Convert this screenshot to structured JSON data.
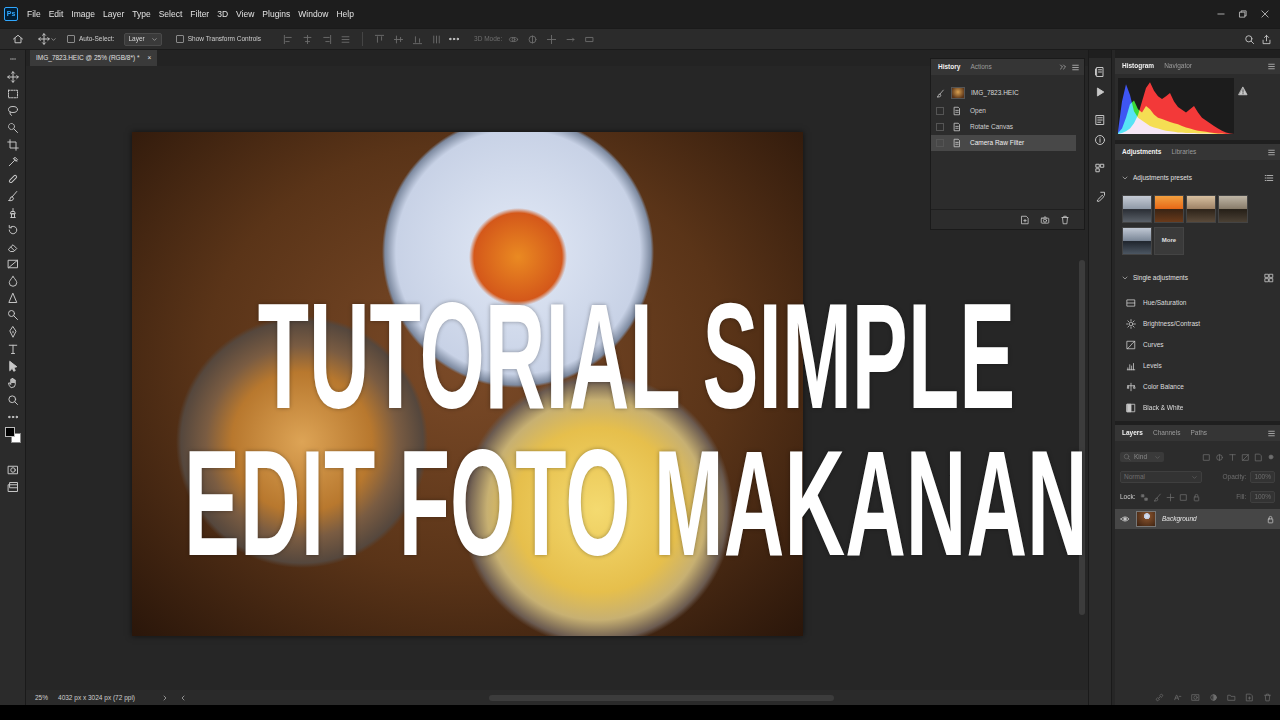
{
  "app": {
    "logo": "Ps"
  },
  "menu": [
    "File",
    "Edit",
    "Image",
    "Layer",
    "Type",
    "Select",
    "Filter",
    "3D",
    "View",
    "Plugins",
    "Window",
    "Help"
  ],
  "options_bar": {
    "auto_select": {
      "label": "Auto-Select:",
      "checked": false
    },
    "target": "Layer",
    "show_transform": {
      "label": "Show Transform Controls",
      "checked": false
    },
    "mode_3d": {
      "label": "3D Mode:",
      "disabled": true
    }
  },
  "document_tab": {
    "title": "IMG_7823.HEIC @ 25% (RGB/8*) *",
    "close": "×",
    "selected": true
  },
  "overlay_title": [
    "TUTORIAL SIMPLE",
    "EDIT FOTO MAKANAN"
  ],
  "history": {
    "tabs": [
      {
        "label": "History",
        "selected": true
      },
      {
        "label": "Actions",
        "selected": false
      }
    ],
    "snapshot": "IMG_7823.HEIC",
    "steps": [
      {
        "label": "Open",
        "selected": false
      },
      {
        "label": "Rotate Canvas",
        "selected": false
      },
      {
        "label": "Camera Raw Filter",
        "selected": true
      }
    ]
  },
  "histogram": {
    "tabs": [
      {
        "label": "Histogram",
        "selected": true
      },
      {
        "label": "Navigator",
        "selected": false
      }
    ],
    "series": [
      {
        "color": "#2844ff",
        "values": [
          5,
          60,
          92,
          72,
          42,
          30,
          25,
          20,
          15,
          12,
          10,
          8,
          6,
          5,
          4,
          3,
          3,
          2,
          2,
          2,
          1,
          1,
          1,
          1,
          0,
          0,
          0,
          0,
          0,
          0
        ]
      },
      {
        "color": "#22e022",
        "values": [
          2,
          10,
          30,
          55,
          62,
          46,
          40,
          52,
          46,
          36,
          30,
          28,
          25,
          22,
          20,
          18,
          15,
          12,
          10,
          8,
          6,
          5,
          4,
          3,
          2,
          1,
          1,
          0,
          0,
          0
        ]
      },
      {
        "color": "#ff2222",
        "values": [
          0,
          2,
          5,
          10,
          20,
          35,
          60,
          85,
          96,
          80,
          70,
          65,
          70,
          76,
          60,
          50,
          45,
          40,
          46,
          52,
          40,
          30,
          25,
          20,
          15,
          10,
          6,
          3,
          1,
          0
        ]
      }
    ]
  },
  "adjustments": {
    "tabs": [
      {
        "label": "Adjustments",
        "selected": true
      },
      {
        "label": "Libraries",
        "selected": false
      }
    ],
    "presets_title": "Adjustments presets",
    "presets_expanded": true,
    "presets_more": "More",
    "single_title": "Single adjustments",
    "single_expanded": true,
    "items": [
      "Hue/Saturation",
      "Brightness/Contrast",
      "Curves",
      "Levels",
      "Color Balance",
      "Black & White"
    ]
  },
  "layers": {
    "tabs": [
      {
        "label": "Layers",
        "selected": true
      },
      {
        "label": "Channels",
        "selected": false
      },
      {
        "label": "Paths",
        "selected": false
      }
    ],
    "kind_filter": "Kind",
    "blend_mode": {
      "value": "Normal",
      "disabled": true
    },
    "opacity": {
      "label": "Opacity:",
      "value": "100%",
      "disabled": true
    },
    "lock_label": "Lock:",
    "fill": {
      "label": "Fill:",
      "value": "100%",
      "disabled": true
    },
    "items": [
      {
        "name": "Background",
        "visible": true,
        "selected": true,
        "locked": true
      }
    ]
  },
  "status_bar": {
    "zoom": "25%",
    "info": "4032 px x 3024 px (72 ppi)"
  }
}
